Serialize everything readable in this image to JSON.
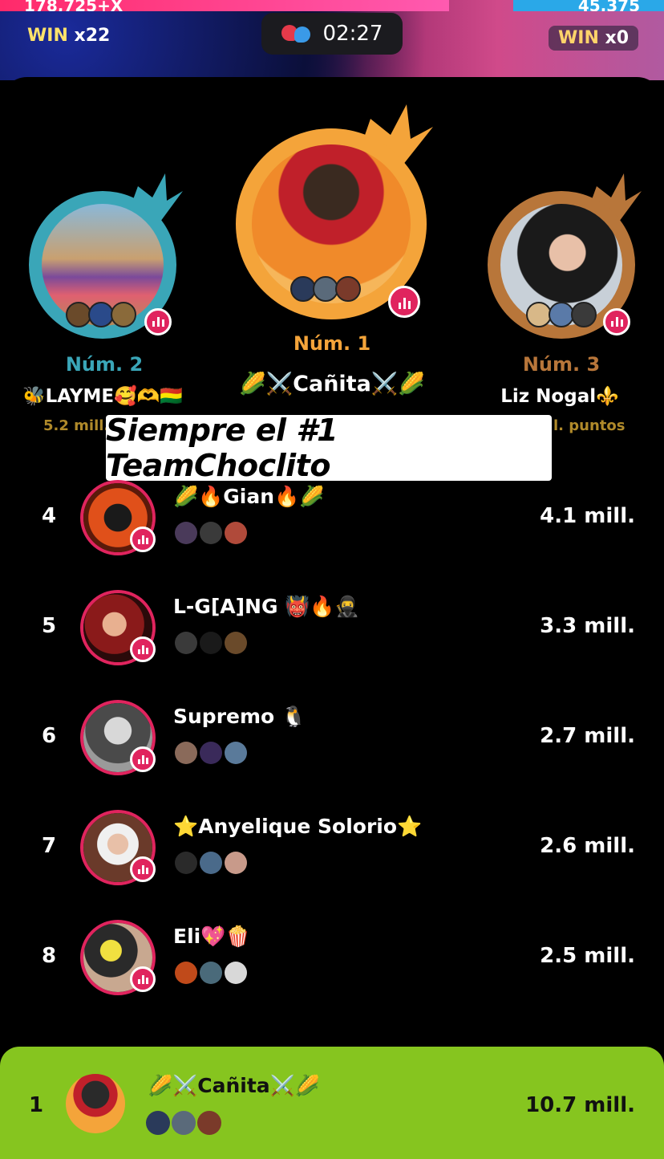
{
  "header": {
    "left_score": "178,725+X",
    "right_score": "45,375",
    "win_left_label": "WIN",
    "win_left_count": "x22",
    "win_right_label": "WIN",
    "win_right_count": "x0",
    "timer": "02:27"
  },
  "podium": {
    "first": {
      "rank": "Núm. 1",
      "name": "🌽⚔️Cañita⚔️🌽",
      "color": "#f4a43a"
    },
    "second": {
      "rank": "Núm. 2",
      "name": "🐝LAYME🥰🫶🇧🇴",
      "points": "5.2 mill.",
      "color": "#3aa6b8"
    },
    "third": {
      "rank": "Núm. 3",
      "name": "Liz Nogal⚜️",
      "points": "l. puntos",
      "color": "#b8763a"
    }
  },
  "caption": "Siempre el #1 TeamChoclito",
  "leaderboard": [
    {
      "rank": "4",
      "name": "🌽🔥Gian🔥🌽",
      "score": "4.1 mill."
    },
    {
      "rank": "5",
      "name": "L-G[A]NG 👹🔥🥷",
      "score": "3.3 mill."
    },
    {
      "rank": "6",
      "name": "Supremo 🐧",
      "score": "2.7 mill."
    },
    {
      "rank": "7",
      "name": "⭐Anyelique Solorio⭐",
      "score": "2.6 mill."
    },
    {
      "rank": "8",
      "name": "Eli💖🍿",
      "score": "2.5 mill."
    }
  ],
  "my_rank": {
    "rank": "1",
    "name": "🌽⚔️Cañita⚔️🌽",
    "score": "10.7 mill."
  },
  "colors": {
    "accent_pink": "#e0245e",
    "bottom_bar": "#86c51f"
  }
}
